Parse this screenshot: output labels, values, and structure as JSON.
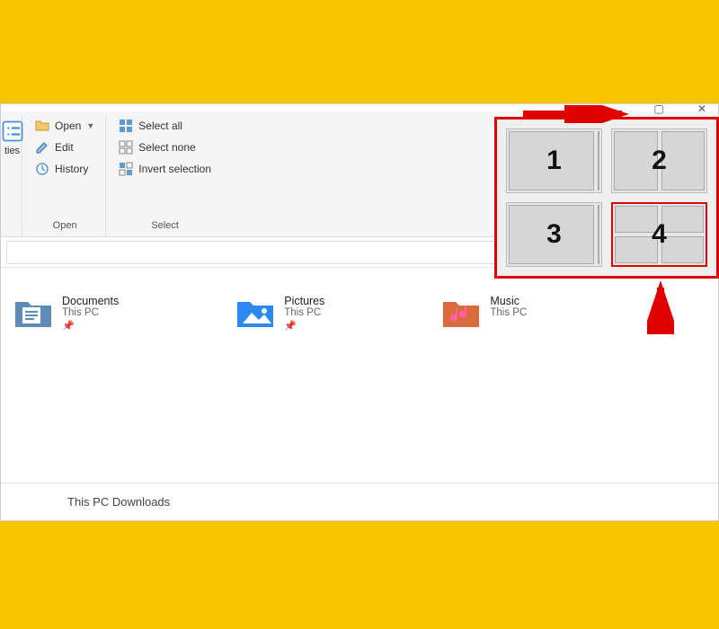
{
  "colors": {
    "page_bg": "#f7c600",
    "highlight_border": "#e00000"
  },
  "title_bar": {
    "maximize_sym": "▢",
    "close_sym": "✕"
  },
  "ribbon": {
    "left_group": {
      "item_label": "ties"
    },
    "open_group": {
      "label": "Open",
      "open_label": "Open",
      "edit_label": "Edit",
      "history_label": "History"
    },
    "select_group": {
      "label": "Select",
      "select_all_label": "Select all",
      "select_none_label": "Select none",
      "invert_label": "Invert selection"
    }
  },
  "address": {
    "chevron_sym": "⌄",
    "refresh_sym": "↻"
  },
  "folders": [
    {
      "name": "Documents",
      "location": "This PC"
    },
    {
      "name": "Pictures",
      "location": "This PC"
    },
    {
      "name": "Music",
      "location": "This PC"
    }
  ],
  "status_text": "This PC Downloads",
  "snap": {
    "labels": [
      "1",
      "2",
      "3",
      "4"
    ]
  }
}
